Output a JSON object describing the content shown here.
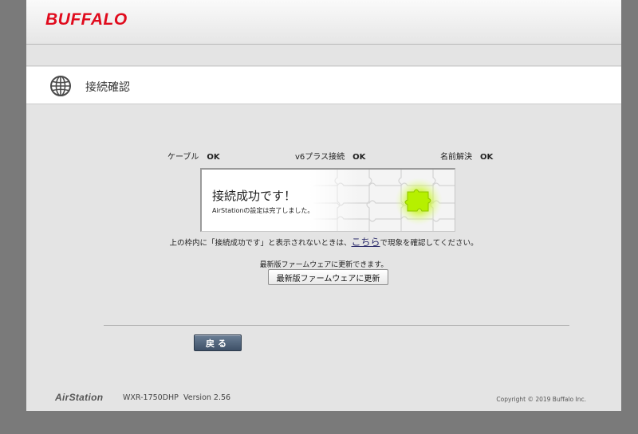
{
  "brand": {
    "logo_text": "BUFFALO",
    "logo_color": "#e00b1d"
  },
  "page": {
    "title": "接続確認",
    "title_icon": "globe-icon"
  },
  "status": [
    {
      "label": "ケーブル",
      "value": "OK"
    },
    {
      "label": "v6プラス接続",
      "value": "OK"
    },
    {
      "label": "名前解決",
      "value": "OK"
    }
  ],
  "result": {
    "message": "接続成功です！",
    "detail": "AirStationの設定は完了しました。"
  },
  "notice": {
    "before": "上の枠内に「接続成功です」と表示されないときは、",
    "link": "こちら",
    "after": "で現象を確認してください。"
  },
  "firmware": {
    "text": "最新版ファームウェアに更新できます。",
    "button_label": "最新版ファームウェアに更新"
  },
  "back_button_label": "戻る",
  "footer": {
    "product": "AirStation",
    "model": "WXR-1750DHP",
    "version": "Version 2.56",
    "copyright": "Copyright © 2019 Buffalo Inc."
  },
  "colors": {
    "accent_green": "#b6f000",
    "back_button": "#4e6077"
  }
}
